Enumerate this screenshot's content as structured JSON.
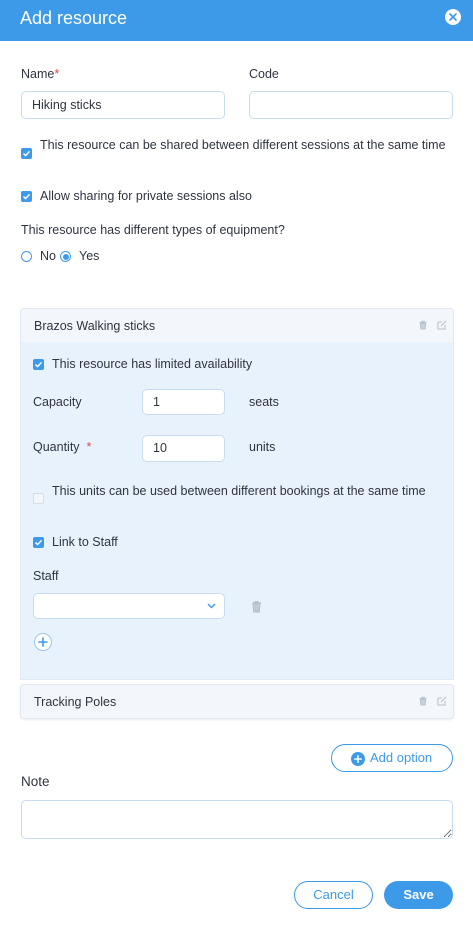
{
  "dialog": {
    "title": "Add resource"
  },
  "form": {
    "name_label": "Name",
    "required_mark": "*",
    "name_value": "Hiking sticks",
    "code_label": "Code",
    "code_value": "",
    "shared_sessions": {
      "label": "This resource can be shared between different sessions at the same time",
      "checked": true
    },
    "private_sessions": {
      "label": "Allow sharing for private sessions also",
      "checked": true
    },
    "equipment_question": "This resource has different types of equipment?",
    "equipment_options": [
      {
        "label": "No",
        "selected": false
      },
      {
        "label": "Yes",
        "selected": true
      }
    ]
  },
  "equipment": [
    {
      "name": "Brazos Walking sticks",
      "expanded": true,
      "limited_availability": {
        "label": "This resource has limited availability",
        "checked": true
      },
      "capacity": {
        "label": "Capacity",
        "value": "1",
        "unit": "seats"
      },
      "quantity": {
        "label": "Quantity",
        "required_mark": "*",
        "value": "10",
        "unit": "units"
      },
      "units_shared": {
        "label": "This units can be used between different bookings at the same time",
        "checked": false
      },
      "link_staff": {
        "label": "Link to Staff",
        "checked": true
      },
      "staff_label": "Staff",
      "staff_value": ""
    },
    {
      "name": "Tracking Poles",
      "expanded": false
    }
  ],
  "actions": {
    "add_option_label": "Add option",
    "note_label": "Note",
    "note_value": "",
    "cancel_label": "Cancel",
    "save_label": "Save"
  },
  "colors": {
    "accent": "#3d9ae8",
    "required": "#e0474c",
    "panel_bg": "#e8f2fc"
  },
  "icons": {
    "close": "close-icon",
    "delete": "trash-icon",
    "edit": "edit-icon",
    "add": "plus-icon",
    "dropdown": "chevron-down-icon"
  }
}
